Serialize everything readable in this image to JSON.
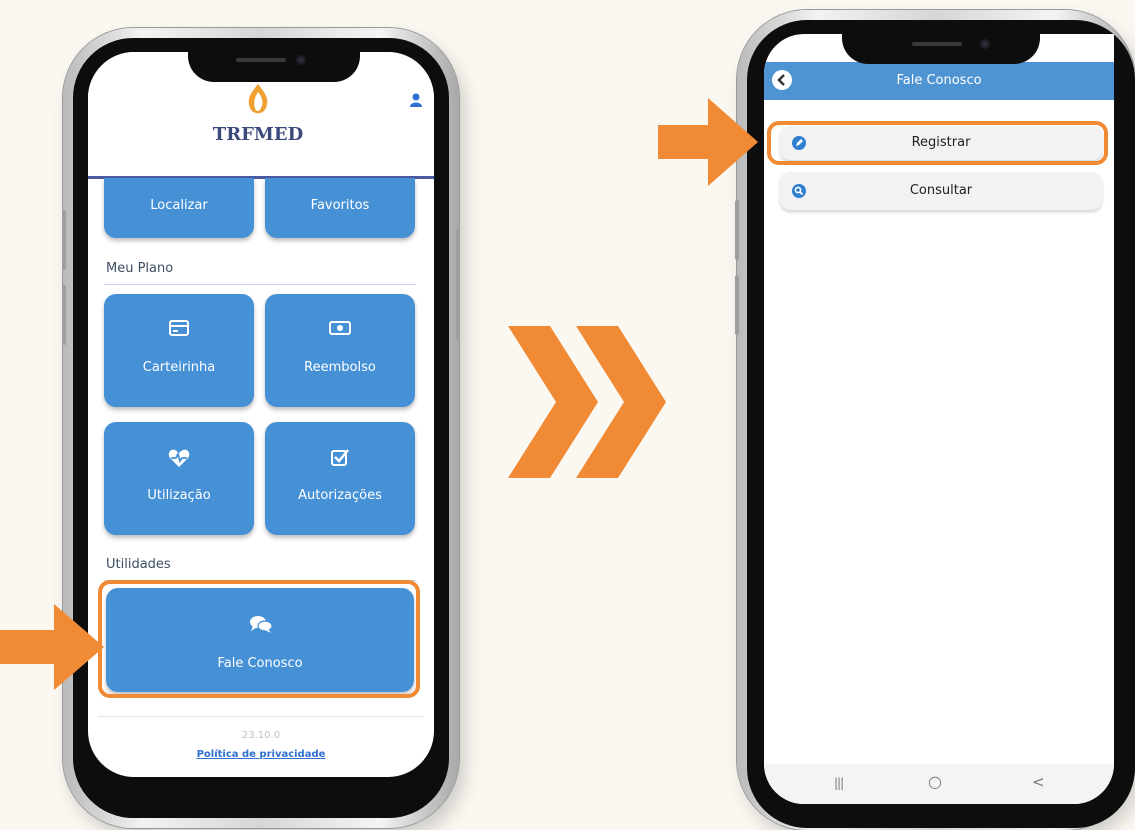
{
  "left_phone": {
    "logo_text": "TRFMED",
    "tiles_top": [
      {
        "label": "Localizar"
      },
      {
        "label": "Favoritos"
      }
    ],
    "section_plan": "Meu Plano",
    "tiles_plan": [
      {
        "label": "Carteirinha",
        "icon": "id-card-icon"
      },
      {
        "label": "Reembolso",
        "icon": "money-icon"
      },
      {
        "label": "Utilização",
        "icon": "heart-pulse-icon"
      },
      {
        "label": "Autorizações",
        "icon": "check-square-icon"
      }
    ],
    "section_util": "Utilidades",
    "contact_tile": {
      "label": "Fale Conosco",
      "icon": "chat-bubbles-icon"
    },
    "version": "23.10.0",
    "privacy_link": "Política de privacidade"
  },
  "right_phone": {
    "header_title": "Fale Conosco",
    "buttons": [
      {
        "label": "Registrar",
        "icon": "edit-icon"
      },
      {
        "label": "Consultar",
        "icon": "search-icon"
      }
    ],
    "navbar": [
      "|||",
      "○",
      "<"
    ]
  },
  "colors": {
    "accent_orange": "#f08a35",
    "app_blue": "#4691d6",
    "header_blue": "#4e94d3"
  }
}
